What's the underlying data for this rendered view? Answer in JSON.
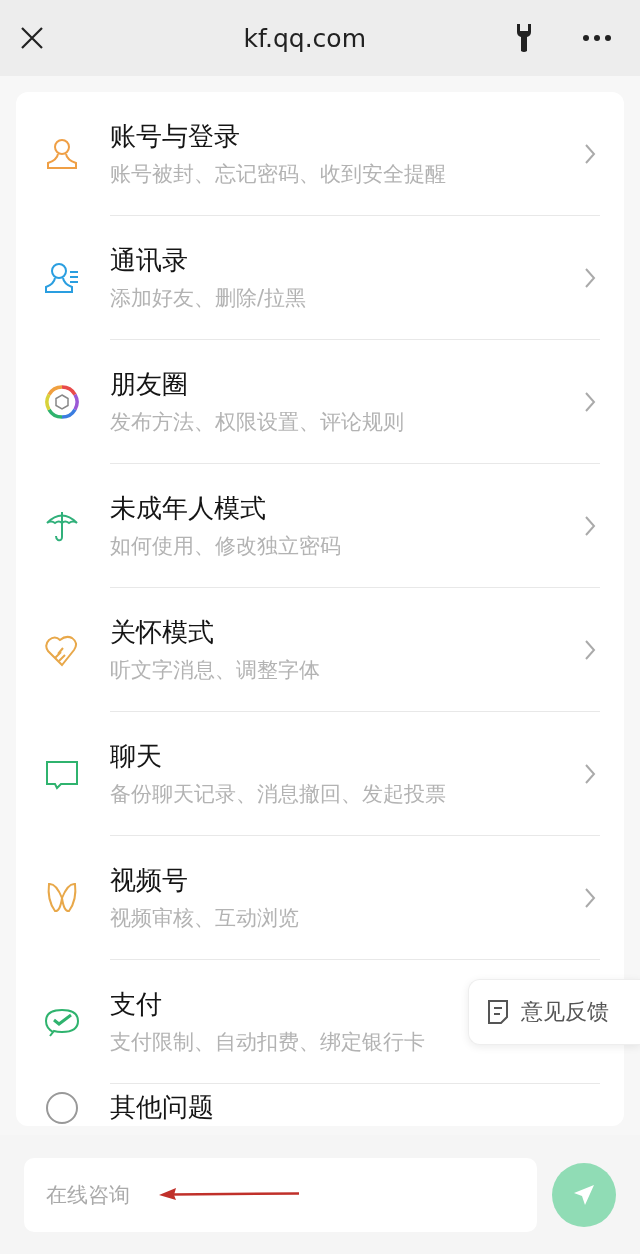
{
  "top_bar": {
    "url": "kf.qq.com"
  },
  "menu": [
    {
      "kind": "person",
      "title": "账号与登录",
      "subtitle": "账号被封、忘记密码、收到安全提醒",
      "chevron": true
    },
    {
      "kind": "contacts",
      "title": "通讯录",
      "subtitle": "添加好友、删除/拉黑",
      "chevron": true
    },
    {
      "kind": "aperture",
      "title": "朋友圈",
      "subtitle": "发布方法、权限设置、评论规则",
      "chevron": true
    },
    {
      "kind": "umbrella",
      "title": "未成年人模式",
      "subtitle": "如何使用、修改独立密码",
      "chevron": true
    },
    {
      "kind": "care",
      "title": "关怀模式",
      "subtitle": "听文字消息、调整字体",
      "chevron": true
    },
    {
      "kind": "chat",
      "title": "聊天",
      "subtitle": "备份聊天记录、消息撤回、发起投票",
      "chevron": true
    },
    {
      "kind": "channels",
      "title": "视频号",
      "subtitle": "视频审核、互动浏览",
      "chevron": true
    },
    {
      "kind": "pay",
      "title": "支付",
      "subtitle": "支付限制、自动扣费、绑定银行卡",
      "chevron": false
    },
    {
      "kind": "other",
      "title": "其他问题",
      "chevron": false
    }
  ],
  "feedback_button": {
    "label": "意见反馈"
  },
  "chat_input": {
    "placeholder": "在线咨询"
  },
  "send_button": {
    "disabled": true
  }
}
